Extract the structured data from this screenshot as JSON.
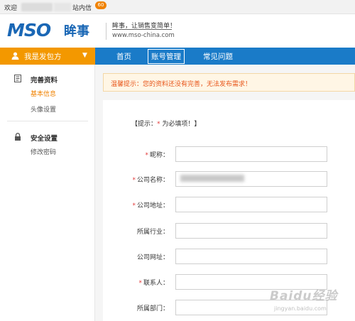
{
  "topbar": {
    "welcome": "欢迎",
    "messages_label": "站内信",
    "messages_count": "60"
  },
  "header": {
    "logo_text": "MSO",
    "logo_cn": "眸事",
    "slogan": "眸事，让销售变简单！",
    "site_url": "www.mso-china.com"
  },
  "nav": {
    "who_label": "我是发包方",
    "items": [
      "首页",
      "账号管理",
      "常见问题"
    ],
    "active_index": 1
  },
  "sidebar": {
    "groups": [
      {
        "title": "完善资料",
        "icon": "document-icon",
        "items": [
          "基本信息",
          "头像设置"
        ],
        "active": "基本信息"
      },
      {
        "title": "安全设置",
        "icon": "lock-icon",
        "items": [
          "修改密码"
        ]
      }
    ]
  },
  "alert": {
    "text": "温馨提示：您的资料还没有完善，无法发布需求！"
  },
  "form": {
    "tip_prefix": "【提示：",
    "tip_star": "*",
    "tip_suffix": " 为必填项！】",
    "fields": [
      {
        "label": "昵称：",
        "required": true,
        "value": ""
      },
      {
        "label": "公司名称：",
        "required": true,
        "value": ""
      },
      {
        "label": "公司地址：",
        "required": true,
        "value": ""
      },
      {
        "label": "所属行业：",
        "required": false,
        "value": ""
      },
      {
        "label": "公司网址：",
        "required": false,
        "value": ""
      },
      {
        "label": "联系人：",
        "required": true,
        "value": ""
      },
      {
        "label": "所属部门：",
        "required": false,
        "value": ""
      }
    ]
  },
  "watermark": {
    "text": "Baidu经验",
    "sub": "jingyan.baidu.com"
  },
  "colors": {
    "brand_blue": "#1a7bc8",
    "accent_orange": "#f39800",
    "alert_red": "#e8561a"
  }
}
